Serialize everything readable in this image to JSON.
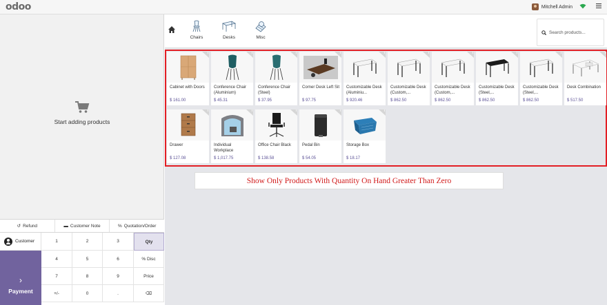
{
  "header": {
    "logo": "odoo",
    "user_name": "Mitchell Admin"
  },
  "cart": {
    "empty_label": "Start adding products"
  },
  "controls": {
    "refund": "Refund",
    "customer_note": "Customer Note",
    "quotation": "Quotation/Order"
  },
  "pad": {
    "customer": "Customer",
    "payment": "Payment",
    "keys": [
      "1",
      "2",
      "3",
      "Qty",
      "4",
      "5",
      "6",
      "% Disc",
      "7",
      "8",
      "9",
      "Price",
      "+/-",
      "0",
      ".",
      "⌫"
    ]
  },
  "categories": [
    {
      "label": "Chairs",
      "icon": "chair-icon"
    },
    {
      "label": "Desks",
      "icon": "desk-icon"
    },
    {
      "label": "Misc",
      "icon": "misc-icon"
    }
  ],
  "search": {
    "placeholder": "Search products..."
  },
  "products": [
    {
      "name": "Cabinet with Doors",
      "price": "$ 161.00",
      "icon": "cabinet"
    },
    {
      "name": "Conference Chair (Aluminium)",
      "price": "$ 45.31",
      "icon": "chair"
    },
    {
      "name": "Conference Chair (Steel)",
      "price": "$ 37.95",
      "icon": "chair"
    },
    {
      "name": "Corner Desk Left Sit",
      "price": "$ 97.75",
      "icon": "corner-desk"
    },
    {
      "name": "Customizable Desk (Aluminiu...",
      "price": "$ 920.46",
      "icon": "desk"
    },
    {
      "name": "Customizable Desk (Custom,...",
      "price": "$ 862.50",
      "icon": "desk"
    },
    {
      "name": "Customizable Desk (Custom,...",
      "price": "$ 862.50",
      "icon": "desk"
    },
    {
      "name": "Customizable Desk (Steel,...",
      "price": "$ 862.50",
      "icon": "desk-black"
    },
    {
      "name": "Customizable Desk (Steel,...",
      "price": "$ 862.50",
      "icon": "desk"
    },
    {
      "name": "Desk Combination",
      "price": "$ 517.50",
      "icon": "desk-combo"
    },
    {
      "name": "Drawer",
      "price": "$ 127.08",
      "icon": "drawer"
    },
    {
      "name": "Individual Workplace",
      "price": "$ 1,017.75",
      "icon": "workplace"
    },
    {
      "name": "Office Chair Black",
      "price": "$ 138.58",
      "icon": "office-chair"
    },
    {
      "name": "Pedal Bin",
      "price": "$ 54.05",
      "icon": "bin"
    },
    {
      "name": "Storage Box",
      "price": "$ 18.17",
      "icon": "box"
    }
  ],
  "annotation": "Show Only Products With Quantity On Hand Greater Than Zero",
  "colors": {
    "primary": "#71639e",
    "price": "#5c5296",
    "highlight_border": "#e31e24",
    "annotation_text": "#d11a1a"
  }
}
